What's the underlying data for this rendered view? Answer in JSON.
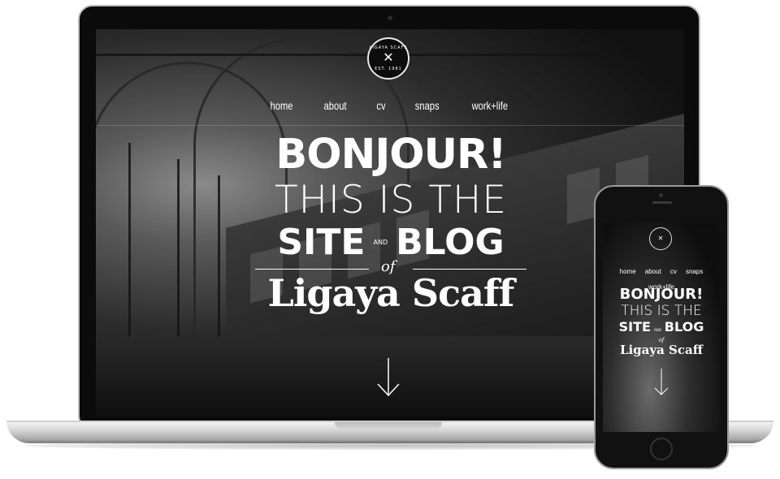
{
  "site": {
    "logo": {
      "name": "LIGAYA SCAFF",
      "est": "EST. 1981"
    },
    "nav": [
      "home",
      "about",
      "cv",
      "snaps",
      "work+life"
    ],
    "hero": {
      "line1": "BONJOUR!",
      "line2": "THIS IS THE",
      "site_word": "SITE",
      "and_word": "AND",
      "blog_word": "BLOG",
      "of_word": "of",
      "name": "Ligaya Scaff"
    }
  },
  "icons": {
    "scroll": "down-arrow-icon",
    "logo": "crossed-tools-icon"
  },
  "colors": {
    "background": "#ffffff",
    "screen_text": "#ffffff",
    "device_frame": "#0b0b0b"
  }
}
